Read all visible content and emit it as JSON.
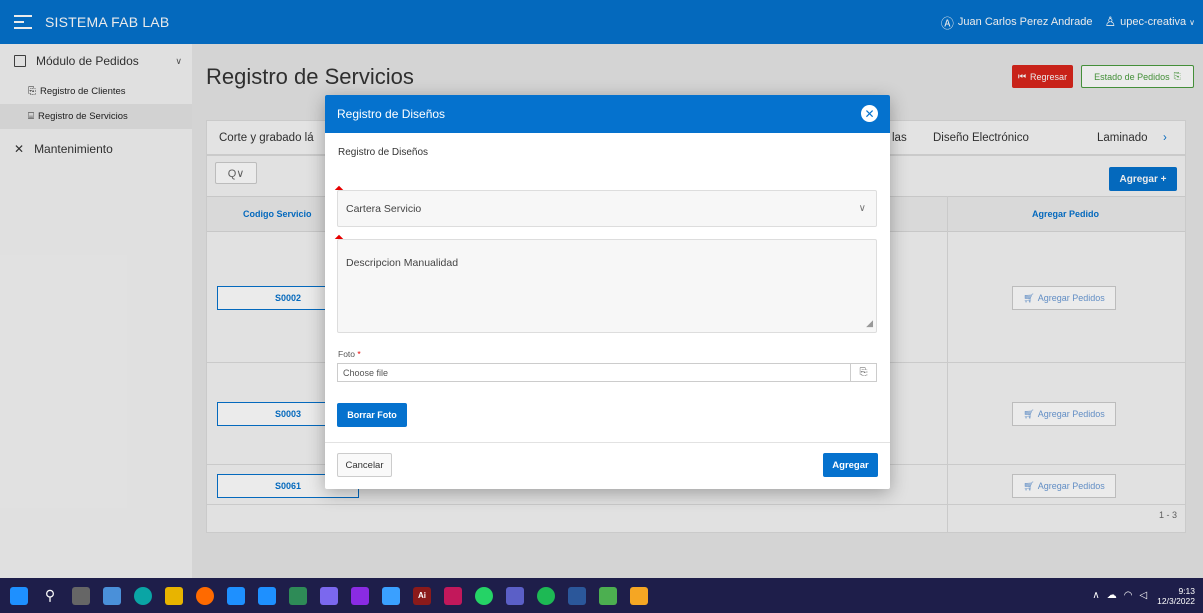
{
  "header": {
    "app_title": "SISTEMA FAB LAB",
    "user_name": "Juan Carlos Perez Andrade",
    "workspace": "upec-creativa"
  },
  "sidebar": {
    "group1": "Módulo de Pedidos",
    "items": [
      {
        "label": "Registro de Clientes"
      },
      {
        "label": "Registro de Servicios"
      }
    ],
    "group2": "Mantenimiento"
  },
  "page": {
    "title": "Registro de Servicios",
    "btn_regresar": "Regresar",
    "btn_estado": "Estado de Pedidos",
    "tabs": [
      "Corte y grabado lá",
      "las",
      "Diseño Electrónico",
      "Laminado"
    ],
    "search_symbol": "Q∨",
    "btn_agregar": "Agregar +",
    "col_codigo": "Codigo Servicio",
    "col_agregar": "Agregar Pedido",
    "rows": [
      {
        "code": "S0002",
        "action": "Agregar Pedidos"
      },
      {
        "code": "S0003",
        "action": "Agregar Pedidos"
      },
      {
        "code": "S0061",
        "action": "Agregar Pedidos"
      }
    ],
    "pagination": "1 - 3"
  },
  "modal": {
    "title": "Registro de Diseños",
    "subtitle": "Registro de Diseños",
    "select_value": "Cartera Servicio",
    "textarea_value": "Descripcion Manualidad",
    "foto_label": "Foto",
    "file_placeholder": "Choose file",
    "btn_borrar": "Borrar Foto",
    "btn_cancelar": "Cancelar",
    "btn_agregar": "Agregar"
  },
  "taskbar": {
    "time": "9:13",
    "date": "12/3/2022"
  },
  "colors": {
    "primary": "#0572ce",
    "danger": "#d9251c",
    "success": "#4a9c3e",
    "taskbar": "#1e1e4a"
  }
}
